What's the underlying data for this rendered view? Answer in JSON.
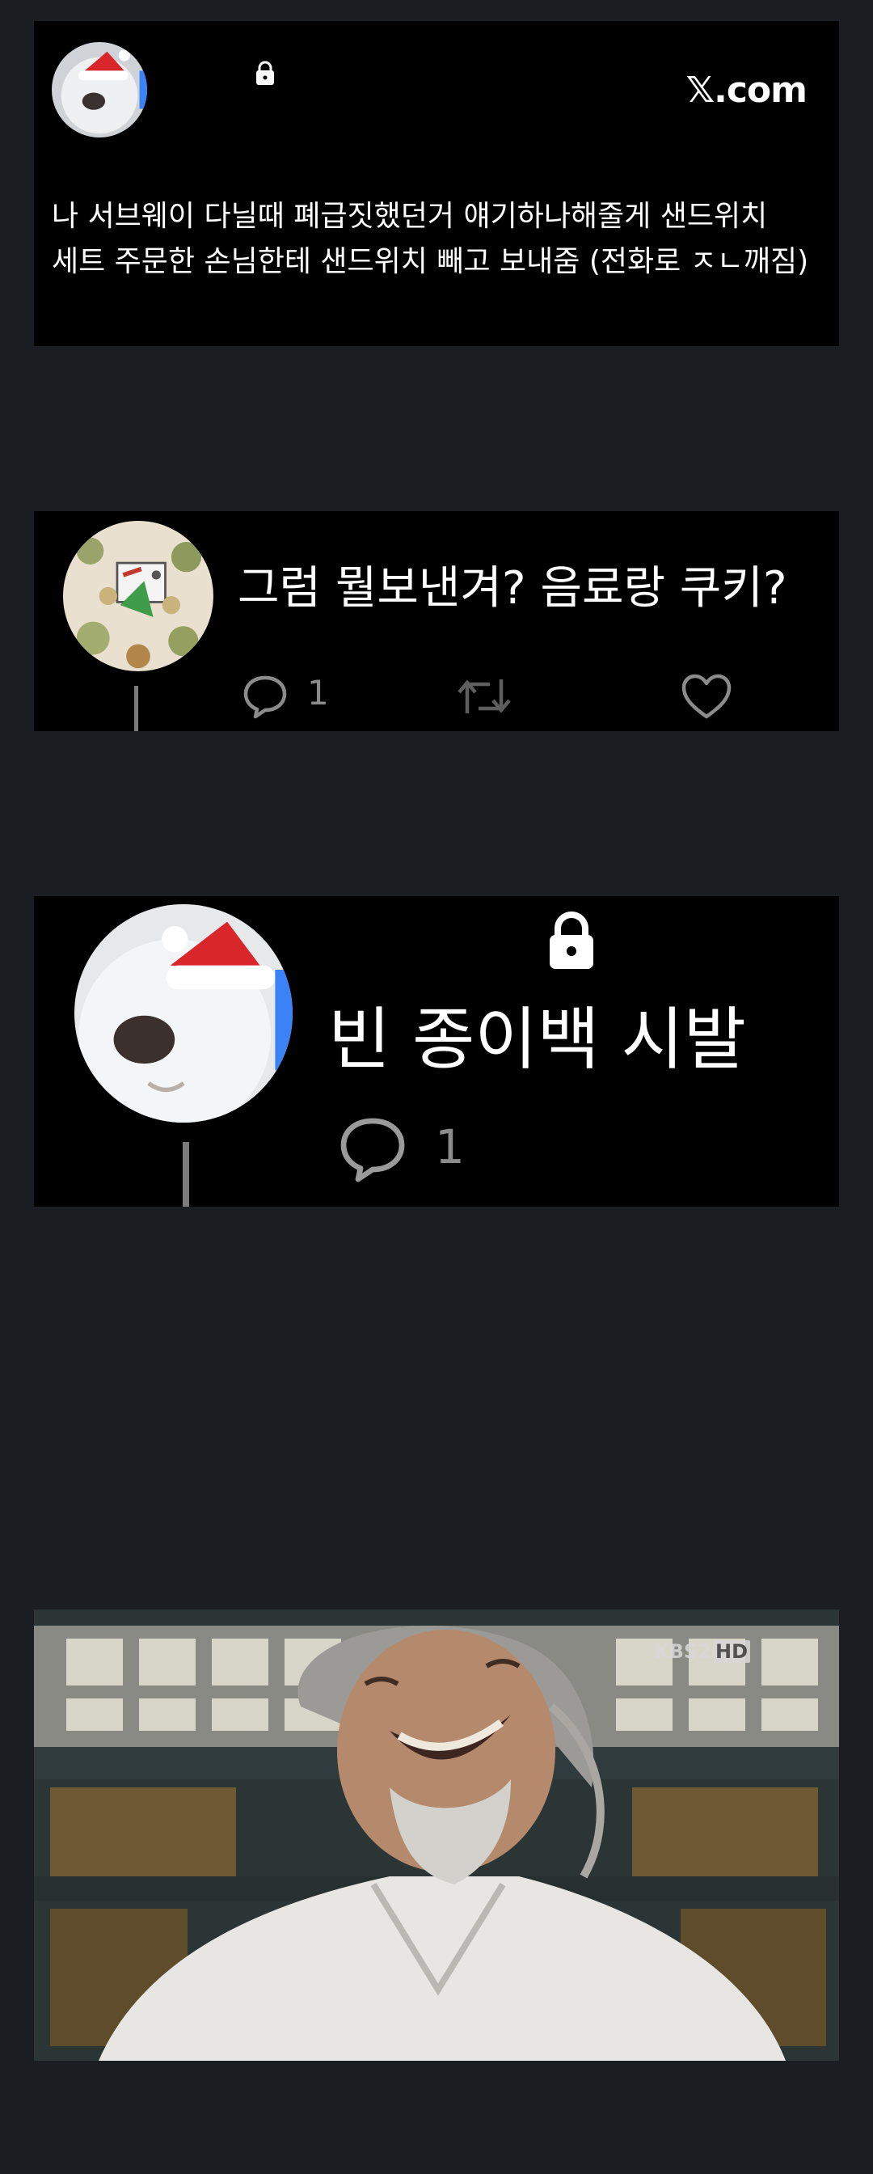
{
  "tweet": {
    "brand": "𝕏.com",
    "text": "나 서브웨이 다닐때 폐급짓했던거 얘기하나해줄게 샌드위치 세트 주문한 손님한테 샌드위치 빼고 보내줌 (전화로 ㅈㄴ깨짐)"
  },
  "reply1": {
    "text": "그럼 뭘보낸겨? 음료랑 쿠키?",
    "reply_count": "1"
  },
  "reply2": {
    "text": "빈 종이백 시발",
    "reply_count": "1"
  },
  "photo": {
    "watermark": "KBS2",
    "watermark_badge": "HD"
  },
  "colors": {
    "background": "#1a1d22",
    "card": "#000000",
    "text": "#ffffff",
    "muted": "#8b8b8b"
  }
}
